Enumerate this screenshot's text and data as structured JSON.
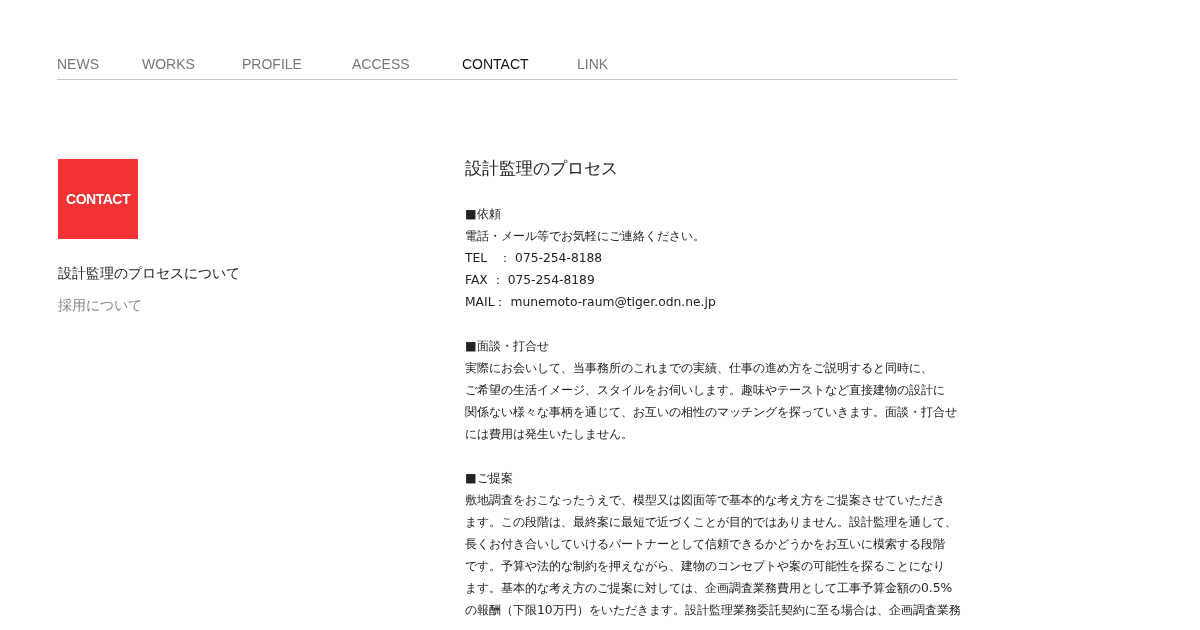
{
  "nav": [
    {
      "label": "NEWS",
      "selected": false
    },
    {
      "label": "WORKS",
      "selected": false
    },
    {
      "label": "PROFILE",
      "selected": false
    },
    {
      "label": "ACCESS",
      "selected": false
    },
    {
      "label": "CONTACT",
      "selected": true
    },
    {
      "label": "LINK",
      "selected": false
    }
  ],
  "sidebar": {
    "badge": "CONTACT",
    "items": [
      {
        "label": "設計監理のプロセスについて",
        "selected": true
      },
      {
        "label": "採用について",
        "selected": false
      }
    ]
  },
  "content": {
    "title": "設計監理のプロセス",
    "sections": [
      {
        "heading": "■依頼",
        "lines": [
          "電話・メール等でお気軽にご連絡ください。"
        ],
        "contacts": [
          {
            "label": "TEL　：",
            "value": "075-254-8188"
          },
          {
            "label": "FAX ：",
            "value": "075-254-8189"
          },
          {
            "label": "MAIL：",
            "value": "munemoto-raum@tiger.odn.ne.jp"
          }
        ]
      },
      {
        "heading": "■面談・打合せ",
        "lines": [
          "実際にお会いして、当事務所のこれまでの実績、仕事の進め方をご説明すると同時に、",
          "ご希望の生活イメージ、スタイルをお伺いします。趣味やテーストなど直接建物の設計に",
          "関係ない様々な事柄を通じて、お互いの相性のマッチングを探っていきます。面談・打合せ",
          "には費用は発生いたしません。"
        ]
      },
      {
        "heading": "■ご提案",
        "lines": [
          "敷地調査をおこなったうえで、模型又は図面等で基本的な考え方をご提案させていただき",
          "ます。この段階は、最終案に最短で近づくことが目的ではありません。設計監理を通して、",
          "長くお付き合いしていけるパートナーとして信頼できるかどうかをお互いに模索する段階",
          "です。予算や法的な制約を押えながら、建物のコンセプトや案の可能性を探ることになり",
          "ます。基本的な考え方のご提案に対しては、企画調査業務費用として工事予算金額の0.5%",
          "の報酬（下限10万円）をいただきます。設計監理業務委託契約に至る場合は、企画調査業務"
        ]
      }
    ]
  }
}
